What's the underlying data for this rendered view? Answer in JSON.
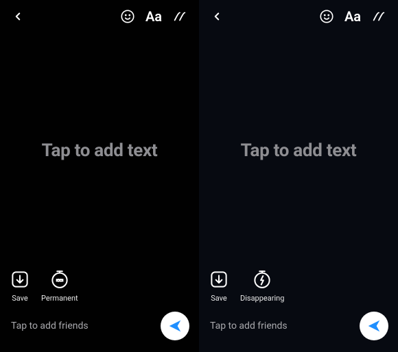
{
  "panels": [
    {
      "topbar": {
        "text_tool": "Aa"
      },
      "placeholder": "Tap to add text",
      "actions": {
        "save": "Save",
        "mode": "Permanent"
      },
      "bottom": {
        "friends": "Tap to add friends"
      }
    },
    {
      "topbar": {
        "text_tool": "Aa"
      },
      "placeholder": "Tap to add text",
      "actions": {
        "save": "Save",
        "mode": "Disappearing"
      },
      "bottom": {
        "friends": "Tap to add friends"
      }
    }
  ]
}
